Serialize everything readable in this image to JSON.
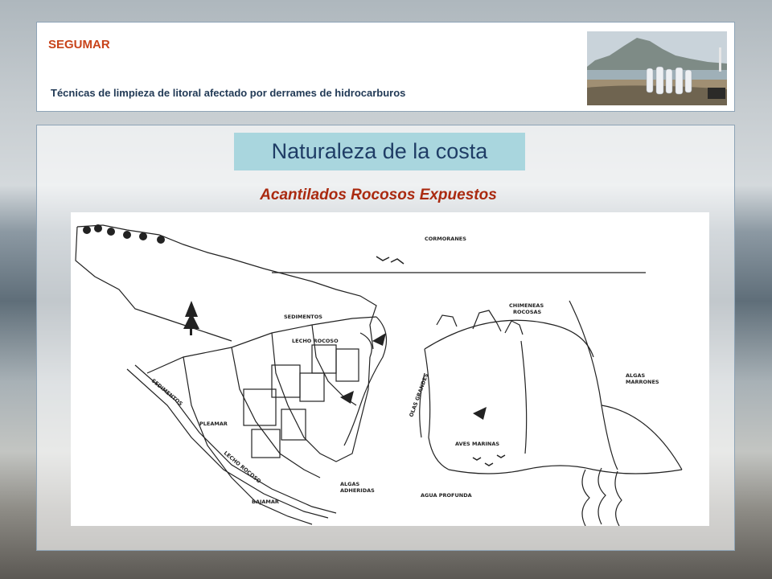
{
  "header": {
    "brand": "SEGUMAR",
    "subtitle": "Técnicas de limpieza de litoral afectado por derrames de hidrocarburos"
  },
  "main": {
    "title": "Naturaleza de la costa",
    "section_title": "Acantilados Rocosos Expuestos"
  },
  "diagram": {
    "labels": {
      "cormoranes": "CORMORANES",
      "chimeneas": "CHIMENEAS",
      "rocosas": "ROCOSAS",
      "sedimentos_top": "SEDIMENTOS",
      "lecho_rocoso_top": "LECHO ROCOSO",
      "sedimentos_side": "SEDIMENTOS",
      "pleamar": "PLEAMAR",
      "lecho_rocoso_bottom": "LECHO ROCOSO",
      "bajamar": "BAJAMAR",
      "algas_adheridas_1": "ALGAS",
      "algas_adheridas_2": "ADHERIDAS",
      "agua_profunda": "AGUA PROFUNDA",
      "olas_grandes": "OLAS GRANDES",
      "aves_marinas": "AVES MARINAS",
      "algas_marrones_1": "ALGAS",
      "algas_marrones_2": "MARRONES"
    }
  },
  "colors": {
    "brand": "#c8431a",
    "subtitle": "#223a56",
    "title_bg": "#a9d6de",
    "title_text": "#1f3d66",
    "section_title": "#aa2a10",
    "panel_border": "#8da3b6"
  }
}
